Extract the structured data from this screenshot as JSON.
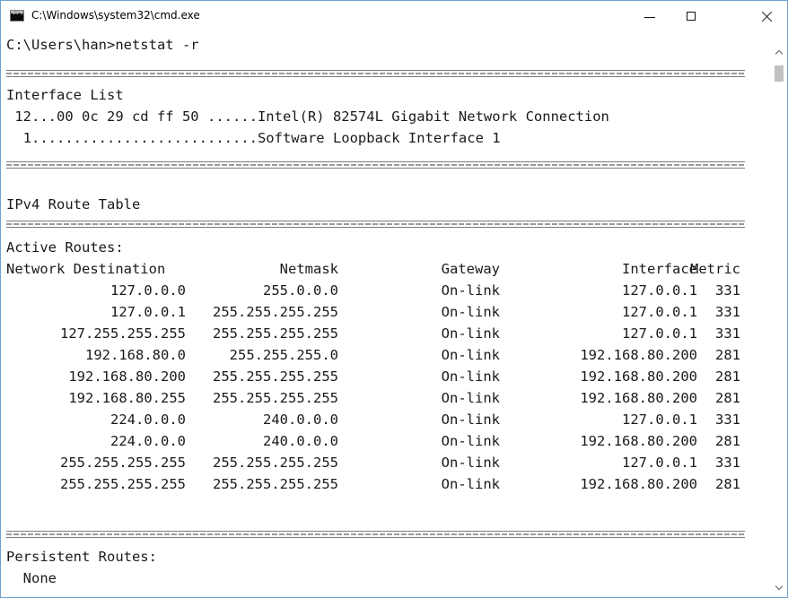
{
  "window": {
    "title": "C:\\Windows\\system32\\cmd.exe",
    "icon": "cmd-icon",
    "icon_glyph": "C:\\",
    "minimize_icon": "minimize-icon",
    "maximize_icon": "maximize-icon",
    "close_icon": "close-icon"
  },
  "console": {
    "prompt_line": "C:\\Users\\han>netstat -r",
    "interface_list_header": "Interface List",
    "interfaces": [
      " 12...00 0c 29 cd ff 50 ......Intel(R) 82574L Gigabit Network Connection",
      "  1...........................Software Loopback Interface 1"
    ],
    "ipv4_header": "IPv4 Route Table",
    "active_routes_header": "Active Routes:",
    "columns": {
      "destination": "Network Destination",
      "netmask": "Netmask",
      "gateway": "Gateway",
      "interface": "Interface",
      "metric": "Metric"
    },
    "routes": [
      {
        "destination": "127.0.0.0",
        "netmask": "255.0.0.0",
        "gateway": "On-link",
        "interface": "127.0.0.1",
        "metric": "331"
      },
      {
        "destination": "127.0.0.1",
        "netmask": "255.255.255.255",
        "gateway": "On-link",
        "interface": "127.0.0.1",
        "metric": "331"
      },
      {
        "destination": "127.255.255.255",
        "netmask": "255.255.255.255",
        "gateway": "On-link",
        "interface": "127.0.0.1",
        "metric": "331"
      },
      {
        "destination": "192.168.80.0",
        "netmask": "255.255.255.0",
        "gateway": "On-link",
        "interface": "192.168.80.200",
        "metric": "281"
      },
      {
        "destination": "192.168.80.200",
        "netmask": "255.255.255.255",
        "gateway": "On-link",
        "interface": "192.168.80.200",
        "metric": "281"
      },
      {
        "destination": "192.168.80.255",
        "netmask": "255.255.255.255",
        "gateway": "On-link",
        "interface": "192.168.80.200",
        "metric": "281"
      },
      {
        "destination": "224.0.0.0",
        "netmask": "240.0.0.0",
        "gateway": "On-link",
        "interface": "127.0.0.1",
        "metric": "331"
      },
      {
        "destination": "224.0.0.0",
        "netmask": "240.0.0.0",
        "gateway": "On-link",
        "interface": "192.168.80.200",
        "metric": "281"
      },
      {
        "destination": "255.255.255.255",
        "netmask": "255.255.255.255",
        "gateway": "On-link",
        "interface": "127.0.0.1",
        "metric": "331"
      },
      {
        "destination": "255.255.255.255",
        "netmask": "255.255.255.255",
        "gateway": "On-link",
        "interface": "192.168.80.200",
        "metric": "281"
      }
    ],
    "persistent_routes_header": "Persistent Routes:",
    "persistent_routes_value": "  None"
  },
  "scrollbar": {
    "up_icon": "chevron-up-icon",
    "down_icon": "chevron-down-icon"
  }
}
